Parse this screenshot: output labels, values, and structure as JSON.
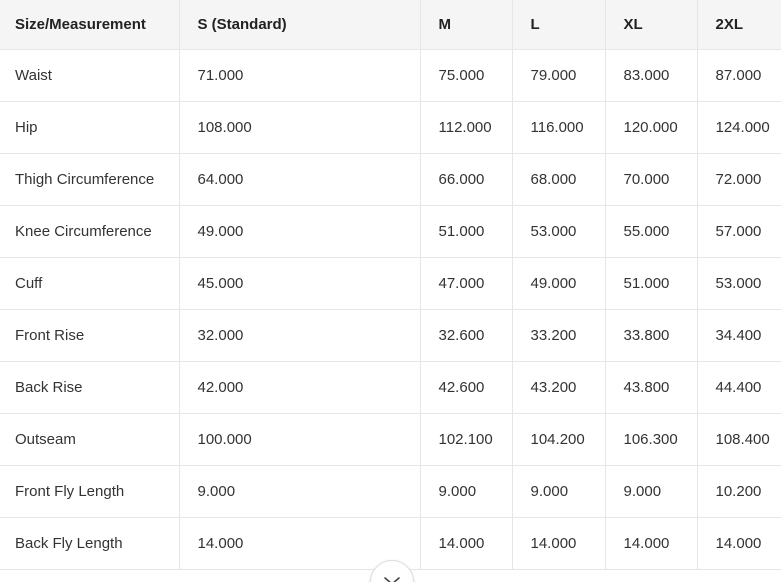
{
  "table": {
    "headers": [
      "Size/Measurement",
      "S (Standard)",
      "M",
      "L",
      "XL",
      "2XL"
    ],
    "rows": [
      [
        "Waist",
        "71.000",
        "75.000",
        "79.000",
        "83.000",
        "87.000"
      ],
      [
        "Hip",
        "108.000",
        "112.000",
        "116.000",
        "120.000",
        "124.000"
      ],
      [
        "Thigh Circumference",
        "64.000",
        "66.000",
        "68.000",
        "70.000",
        "72.000"
      ],
      [
        "Knee Circumference",
        "49.000",
        "51.000",
        "53.000",
        "55.000",
        "57.000"
      ],
      [
        "Cuff",
        "45.000",
        "47.000",
        "49.000",
        "51.000",
        "53.000"
      ],
      [
        "Front Rise",
        "32.000",
        "32.600",
        "33.200",
        "33.800",
        "34.400"
      ],
      [
        "Back Rise",
        "42.000",
        "42.600",
        "43.200",
        "43.800",
        "44.400"
      ],
      [
        "Outseam",
        "100.000",
        "102.100",
        "104.200",
        "106.300",
        "108.400"
      ],
      [
        "Front Fly Length",
        "9.000",
        "9.000",
        "9.000",
        "9.000",
        "10.200"
      ],
      [
        "Back Fly Length",
        "14.000",
        "14.000",
        "14.000",
        "14.000",
        "14.000"
      ]
    ]
  },
  "collapse_button": {
    "icon": "chevron-down-icon"
  },
  "colors": {
    "header_bg": "#f5f5f5",
    "border": "#e6e6e6"
  }
}
